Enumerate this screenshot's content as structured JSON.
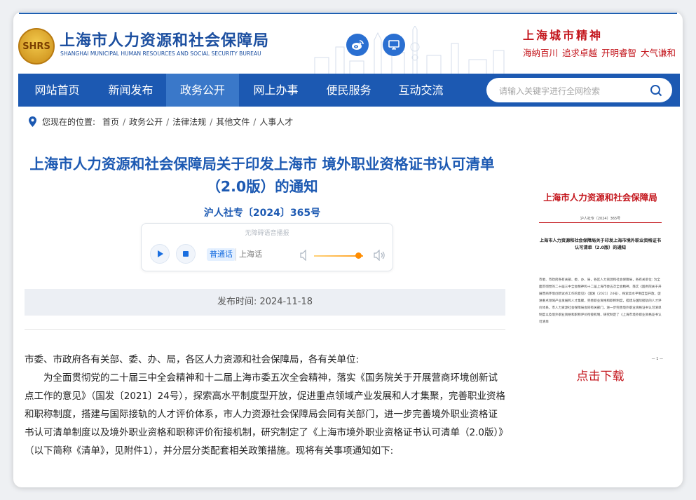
{
  "header": {
    "logo_text": "SHRS",
    "title": "上海市人力资源和社会保障局",
    "subtitle": "SHANGHAI MUNICIPAL HUMAN RESOURCES AND SOCIAL SECURITY BUREAU",
    "city_spirit": "上海城市精神",
    "spirit_words": [
      "海纳百川",
      "追求卓越",
      "开明睿智",
      "大气谦和"
    ],
    "icons": [
      "weibo-icon",
      "desktop-icon"
    ]
  },
  "nav": {
    "items": [
      {
        "label": "网站首页",
        "active": false
      },
      {
        "label": "新闻发布",
        "active": false
      },
      {
        "label": "政务公开",
        "active": true
      },
      {
        "label": "网上办事",
        "active": false
      },
      {
        "label": "便民服务",
        "active": false
      },
      {
        "label": "互动交流",
        "active": false
      }
    ],
    "search_placeholder": "请输入关键字进行全网检索"
  },
  "breadcrumb": {
    "label": "您现在的位置:",
    "items": [
      "首页",
      "政务公开",
      "法律法规",
      "其他文件",
      "人事人才"
    ]
  },
  "article": {
    "title": "上海市人力资源和社会保障局关于印发上海市 境外职业资格证书认可清单（2.0版）的通知",
    "doc_number": "沪人社专〔2024〕365号",
    "publish_label": "发布时间: ",
    "publish_date": "2024-11-18",
    "salutation": "市委、市政府各有关部、委、办、局，各区人力资源和社会保障局，各有关单位:",
    "paragraph": "为全面贯彻党的二十届三中全会精神和十二届上海市委五次全会精神，落实《国务院关于开展营商环境创新试点工作的意见》（国发〔2021〕24号），探索高水平制度型开放，促进重点领域产业发展和人才集聚，完善职业资格和职称制度，搭建与国际接轨的人才评价体系，市人力资源社会保障局会同有关部门，进一步完善境外职业资格证书认可清单制度以及境外职业资格和职称评价衔接机制，研究制定了《上海市境外职业资格证书认可清单（2.0版）》（以下简称《清单》，见附件1），并分层分类配套相关政策措施。现将有关事项通知如下:"
  },
  "player": {
    "caption": "无障碍语音播报",
    "dialect_on": "普通话",
    "dialect_off": "上海话",
    "volume": 0.85
  },
  "thumbnail": {
    "org": "上海市人力资源和社会保障局",
    "doc_no": "沪人社专〔2024〕365号",
    "title": "上海市人力资源和社会保障局关于印发上海市境外职业资格证书认可清单（2.0版）的通知",
    "body": "市委、市政府各有关部、委、办、局，各区人力资源和社会保障局，各有关单位: 为全面贯彻党的二十届三中全会精神和十二届上海市委五次全会精神，落实《国务院关于开展营商环境创新试点工作的意见》（国发〔2021〕24号），探索高水平制度型开放，促进重点领域产业发展和人才集聚，完善职业资格和职称制度，搭建与国际接轨的人才评价体系，市人力资源社会保障局会同有关部门，进一步完善境外职业资格证书认可清单制度以及境外职业资格和职称评价衔接机制，研究制定了《上海市境外职业资格证书认可清单",
    "page": "— 1 —"
  },
  "download_label": "点击下载",
  "colors": {
    "brand_blue": "#1c59b2",
    "nav_active": "#3a78c9",
    "accent_red": "#c3141b"
  }
}
